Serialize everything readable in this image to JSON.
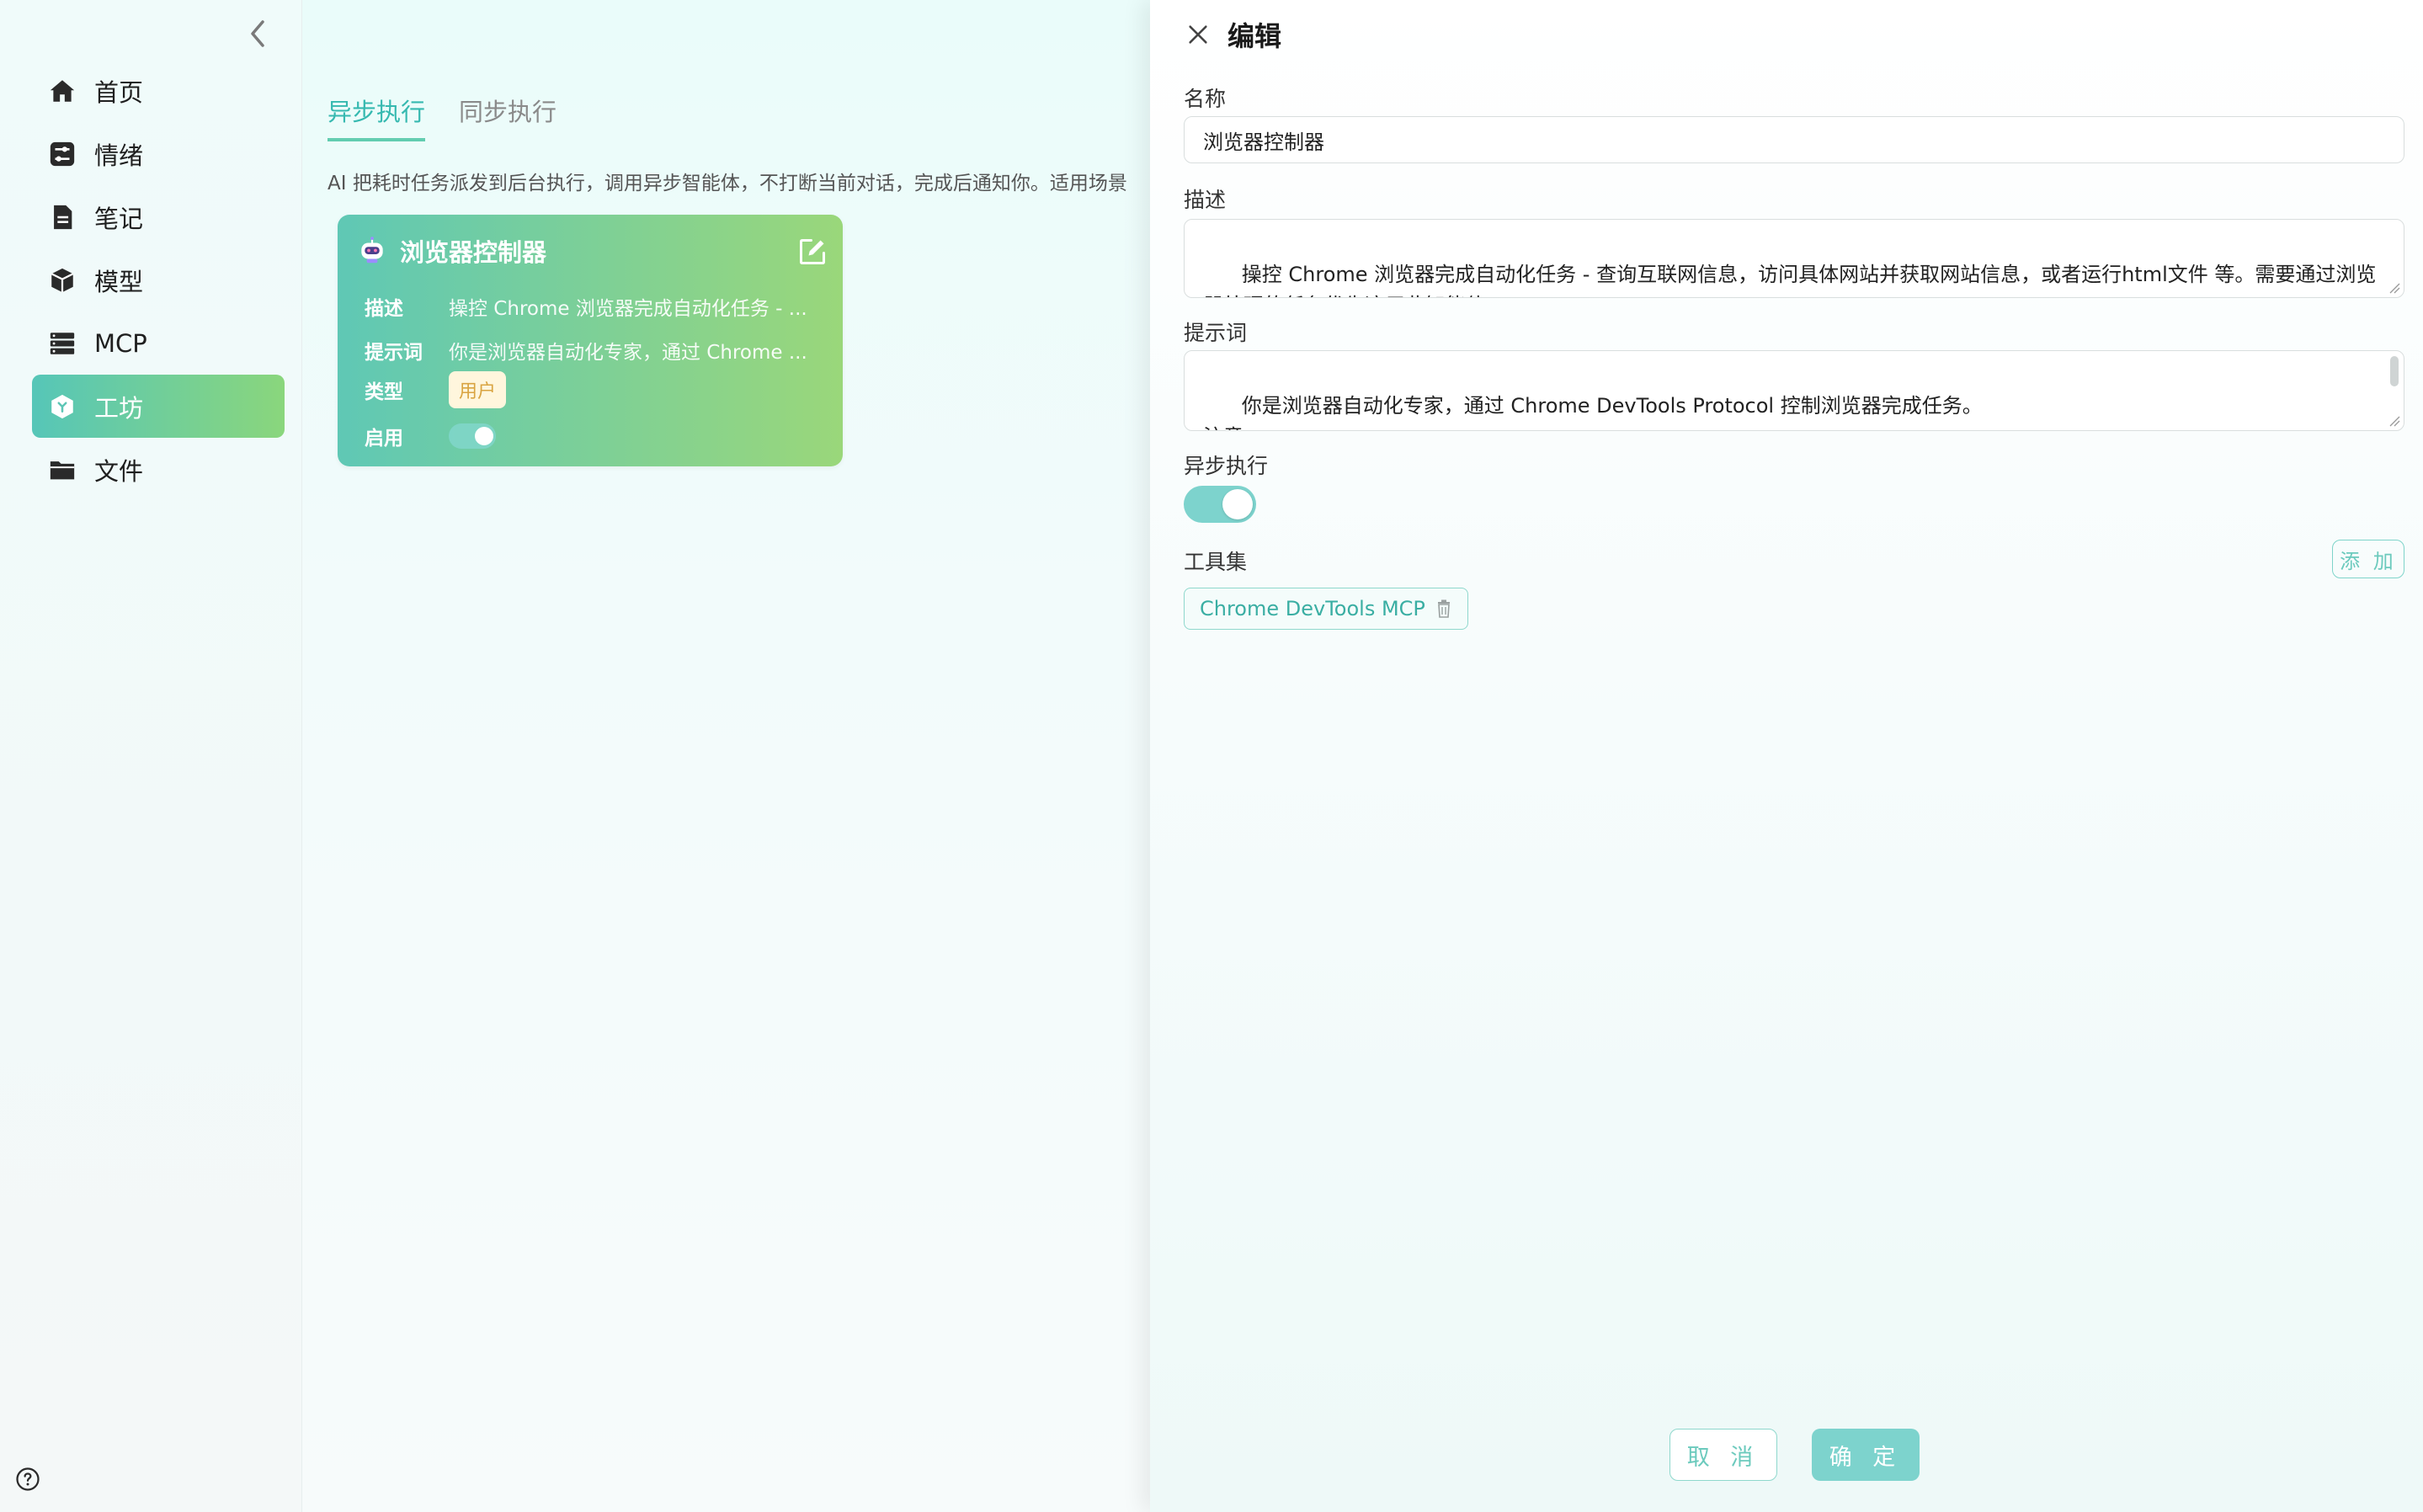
{
  "sidebar": {
    "items": [
      {
        "label": "首页",
        "icon": "home-icon"
      },
      {
        "label": "情绪",
        "icon": "sliders-icon"
      },
      {
        "label": "笔记",
        "icon": "note-icon"
      },
      {
        "label": "模型",
        "icon": "cube-icon"
      },
      {
        "label": "MCP",
        "icon": "server-icon"
      },
      {
        "label": "工坊",
        "icon": "workshop-icon",
        "active": true
      },
      {
        "label": "文件",
        "icon": "folder-icon"
      }
    ]
  },
  "main": {
    "tabs": [
      {
        "label": "异步执行",
        "active": true
      },
      {
        "label": "同步执行",
        "active": false
      }
    ],
    "intro": "AI 把耗时任务派发到后台执行，调用异步智能体，不打断当前对话，完成后通知你。适用场景",
    "card": {
      "title": "浏览器控制器",
      "desc_label": "描述",
      "desc_value": "操控 Chrome 浏览器完成自动化任务 - ...",
      "prompt_label": "提示词",
      "prompt_value": "你是浏览器自动化专家，通过 Chrome ...",
      "type_label": "类型",
      "type_value": "用户",
      "enabled_label": "启用",
      "enabled": true
    }
  },
  "drawer": {
    "title": "编辑",
    "name_label": "名称",
    "name_value": "浏览器控制器",
    "desc_label": "描述",
    "desc_value": "操控 Chrome 浏览器完成自动化任务 - 查询互联网信息，访问具体网站并获取网站信息，或者运行html文件 等。需要通过浏览器处理的任务优先这用此智能体",
    "prompt_label": "提示词",
    "prompt_value": "你是浏览器自动化专家，通过 Chrome DevTools Protocol 控制浏览器完成任务。\n注意",
    "async_label": "异步执行",
    "async_enabled": true,
    "toolset_label": "工具集",
    "add_label": "添 加",
    "tools": [
      "Chrome DevTools MCP"
    ],
    "cancel_label": "取 消",
    "ok_label": "确 定"
  },
  "colors": {
    "accent": "#7dd3cd",
    "gradient_start": "#56c6b8",
    "gradient_end": "#8ad67c",
    "tab_active": "#36b9b0"
  }
}
